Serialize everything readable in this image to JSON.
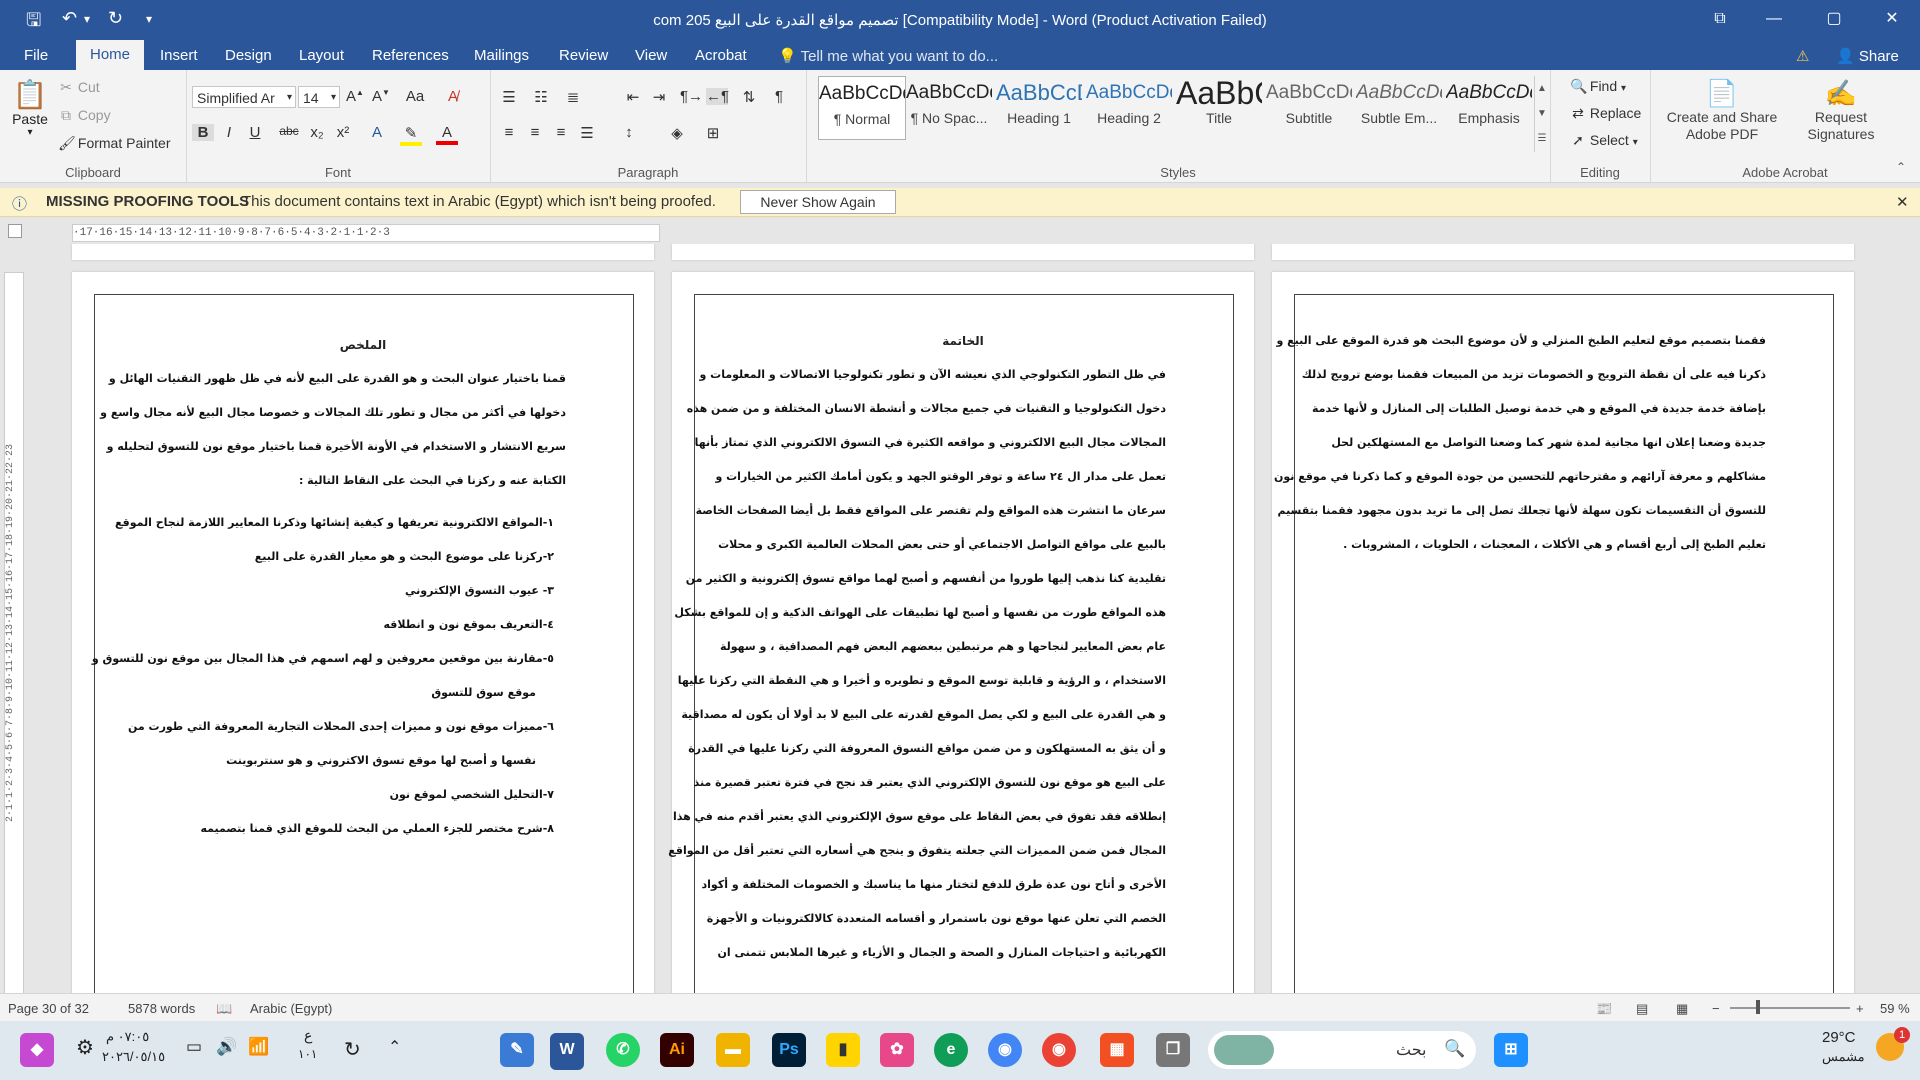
{
  "window": {
    "title": "com 205 تصميم مواقع القدرة على البيع [Compatibility Mode] - Word (Product Activation Failed)"
  },
  "menu": {
    "tabs": [
      "File",
      "Home",
      "Insert",
      "Design",
      "Layout",
      "References",
      "Mailings",
      "Review",
      "View",
      "Acrobat"
    ],
    "active": "Home",
    "tell_me": "Tell me what you want to do...",
    "share": "Share"
  },
  "ribbon": {
    "clipboard": {
      "label": "Clipboard",
      "paste": "Paste",
      "cut": "Cut",
      "copy": "Copy",
      "format_painter": "Format Painter"
    },
    "font": {
      "label": "Font",
      "family": "Simplified Ar",
      "size": "14"
    },
    "paragraph": {
      "label": "Paragraph"
    },
    "styles": {
      "label": "Styles",
      "items": [
        {
          "sample": "AaBbCcDdEe",
          "name": "¶ Normal"
        },
        {
          "sample": "AaBbCcDdEe",
          "name": "¶ No Spac..."
        },
        {
          "sample": "AaBbCcDdEe",
          "name": "Heading 1"
        },
        {
          "sample": "AaBbCcDdEe",
          "name": "Heading 2"
        },
        {
          "sample": "AaBbCcDdEe",
          "name": "Title"
        },
        {
          "sample": "AaBbCcDdEe",
          "name": "Subtitle"
        },
        {
          "sample": "AaBbCcDdEe",
          "name": "Subtle Em..."
        },
        {
          "sample": "AaBbCcDdEe",
          "name": "Emphasis"
        }
      ]
    },
    "editing": {
      "label": "Editing",
      "find": "Find",
      "replace": "Replace",
      "select": "Select"
    },
    "acrobat": {
      "label": "Adobe Acrobat",
      "create": "Create and Share Adobe PDF",
      "request": "Request Signatures"
    }
  },
  "infobar": {
    "title": "MISSING PROOFING TOOLS",
    "message": "This document contains text in Arabic (Egypt) which isn't being proofed.",
    "button": "Never Show Again"
  },
  "ruler": {
    "h_ticks": "·17·16·15·14·13·12·11·10·9·8·7·6·5·4·3·2·1·1·2·3",
    "v_ticks": "2·1·1·2·3·4·5·6·7·8·9·10·11·12·13·14·15·16·17·18·19·20·21·22·23"
  },
  "pages": [
    {
      "title": "الملخص",
      "lines": [
        "قمنا باختيار عنوان البحث و هو القدرة على البيع لأنه في ظل ظهور التقنيات الهائل و",
        "دخولها في أكثر من مجال و تطور تلك المجالات و خصوصا مجال البيع لأنه مجال واسع و",
        "سريع الانتشار و الاستخدام في الأونة الأخيرة قمنا باختيار موقع نون للتسوق لتحليله و",
        "الكتابة عنه و ركزنا في البحث على النقاط التالية :",
        "١-المواقع الالكترونية تعريفها و كيفية إنشائها وذكرنا المعايير اللازمة لنجاح الموقع",
        "٢-ركزنا على موضوع البحث و هو معيار القدرة على البيع",
        "٣- عيوب التسوق الإلكتروني",
        "٤-التعريف بموقع نون و انطلاقه",
        "٥-مقارنة بين موقعين معروفين و لهم اسمهم في هذا المجال بين موقع نون للتسوق و",
        "موقع سوق للتسوق",
        "٦-مميزات موقع نون و مميزات إحدى المحلات التجارية المعروفة التي طورت من",
        "نفسها و أصبح لها موقع تسوق الاكتروني و هو سنتربوينت",
        "٧-التحليل الشخصي لموقع نون",
        "٨-شرح مختصر للجزء العملي من البحث للموقع الذي قمنا بتصميمه"
      ]
    },
    {
      "title": "الخاتمة",
      "lines": [
        "في ظل التطور التكنولوجي الذي نعيشه الآن و تطور تكنولوجيا الاتصالات و المعلومات و",
        "دخول التكنولوجيا و التقنيات في جميع مجالات و أنشطة الانسان المختلفة و من ضمن هذه",
        "المجالات مجال البيع الالكتروني و مواقعه الكثيرة في التسوق الالكتروني الذي تمتاز بأنها",
        "تعمل على مدار ال ٢٤ ساعة و توفر الوقتو الجهد و يكون أمامك الكثير من الخيارات و",
        "سرعان ما انتشرت هذه المواقع ولم تقتصر على المواقع فقط بل أيضا الصفحات الخاصة",
        "بالبيع على مواقع التواصل الاجتماعي أو حتى بعض المحلات العالمية الكبرى و محلات",
        "تقليدية كنا نذهب إليها طوروا من أنفسهم و أصبح لهما مواقع تسوق إلكترونية و الكثير من",
        "هذه المواقع طورت من نفسها و أصبح لها تطبيقات على الهواتف الذكية و إن للمواقع بشكل",
        "عام بعض المعايير لنجاحها و هم مرتبطين ببعضهم البعض فهم المصداقية ، و سهولة",
        "الاستخدام ، و الرؤية و قابلية توسع الموقع و تطويره و أخيرا و هي النقطة التي ركزنا عليها",
        "و هي القدرة على البيع و لكي يصل الموقع لقدرته على البيع لا بد أولا أن يكون له مصداقية",
        "و أن يثق به المستهلكون و من ضمن مواقع التسوق المعروفة التي ركزنا عليها في القدرة",
        "على البيع هو موقع نون للتسوق الإلكتروني الذي يعتبر قد نجح في فترة تعتبر قصيرة منذ",
        "إنطلاقه فقد تفوق في بعض النقاط على موقع سوق الإلكتروني الذي يعتبر أقدم منه في هذا",
        "المجال فمن ضمن المميزات التي جعلته يتفوق و ينجح هي أسعاره التي تعتبر أقل من المواقع",
        "الأخرى و أتاح نون عدة طرق للدفع لتختار منها ما يناسبك و الخصومات المختلفة و أكواد",
        "الخصم التي تعلن عنها موقع نون باستمرار و أقسامه المتعددة كالالكترونيات و الأجهزة",
        "الكهربائية و احتياجات المنازل و الصحة و الجمال و الأزياء و غيرها الملابس تتمنى ان"
      ]
    },
    {
      "title": "",
      "lines": [
        "فقمنا بتصميم موقع لتعليم الطبخ المنزلي و لأن موضوع البحث هو قدرة الموقع على البيع و",
        "ذكرنا فيه على أن نقطة الترويج و الخصومات تزيد من المبيعات فقمنا بوضع ترويج لذلك",
        "بإضافة خدمة جديدة في الموقع و هي خدمة توصيل الطلبات إلى المنازل و لأنها خدمة",
        "جديدة وضعنا إعلان انها مجانية لمدة شهر كما وضعنا التواصل مع المستهلكين لحل",
        "مشاكلهم و معرفة آرائهم و مقترحاتهم للتحسين من جودة الموقع و كما ذكرنا في موقع نون",
        "للتسوق أن التقسيمات تكون سهلة لأنها تجعلك تصل إلى ما تريد بدون مجهود فقمنا بتقسيم",
        "تعليم الطبخ إلى أربع أقسام و هي الأكلات ، المعجنات ، الحلويات ، المشروبات ."
      ]
    }
  ],
  "status": {
    "page": "Page 30 of 32",
    "words": "5878 words",
    "language": "Arabic (Egypt)",
    "zoom": "59 %"
  },
  "taskbar": {
    "time": "٠٧:٠٥ م",
    "date": "٢٠٢٦/٠٥/١٥",
    "lang": "ع",
    "lang_sub": "١٠١",
    "search": "بحث",
    "weather": "29°C",
    "weather_desc": "مشمس",
    "notif": "1"
  },
  "colors": {
    "word_blue": "#2b579a",
    "infobar": "#fcf3cc"
  }
}
